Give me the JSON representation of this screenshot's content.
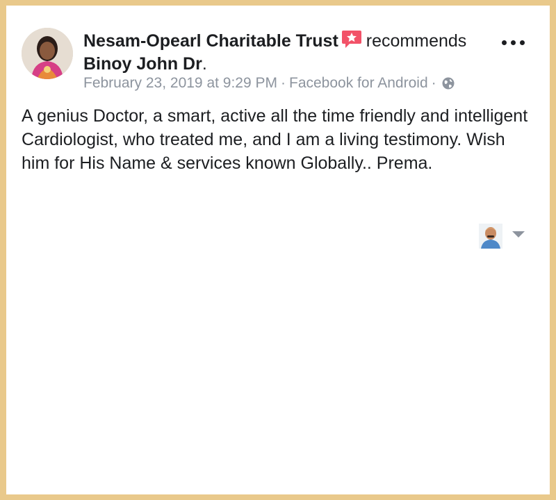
{
  "post": {
    "author": "Nesam-Opearl Charitable Trust",
    "verb": "recommends",
    "target": "Binoy John Dr",
    "target_suffix": ".",
    "date": "February 23, 2019 at 9:29 PM",
    "separator": "·",
    "source": "Facebook for Android",
    "privacy_icon": "globe-icon",
    "badge_icon": "recommendation-star-icon",
    "menu_icon": "more-options-icon",
    "body": "A genius Doctor, a smart, active all the time friendly and intelligent Cardiologist, who treated me, and I am a living testimony. Wish him for His Name & services known Globally.. Prema."
  },
  "colors": {
    "frame": "#e9c98b",
    "badge": "#f25268",
    "text": "#1c1e21",
    "meta": "#8d949e"
  }
}
